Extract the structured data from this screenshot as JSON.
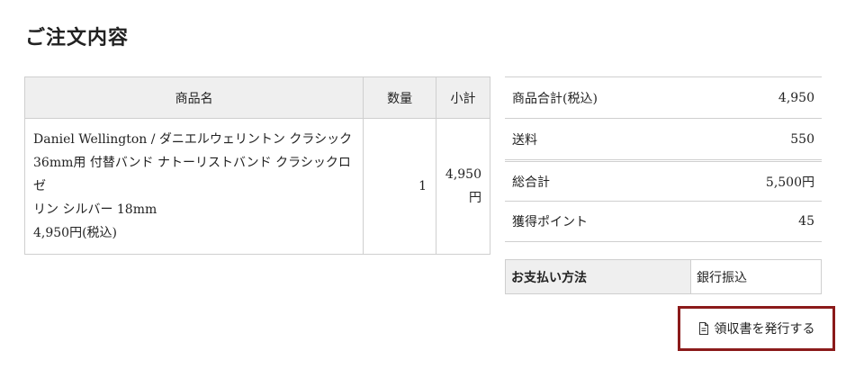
{
  "page": {
    "title": "ご注文内容"
  },
  "items_table": {
    "headers": {
      "name": "商品名",
      "quantity": "数量",
      "subtotal": "小計"
    },
    "rows": [
      {
        "name_lines": [
          "Daniel Wellington / ダニエルウェリントン クラシック",
          "36mm用 付替バンド ナトーリストバンド クラシックロゼ",
          "リン シルバー 18mm",
          "4,950円(税込)"
        ],
        "quantity": "1",
        "subtotal_amount": "4,950",
        "subtotal_unit": "円"
      }
    ]
  },
  "summary": {
    "rows": [
      {
        "label": "商品合計(税込)",
        "value": "4,950"
      },
      {
        "label": "送料",
        "value": "550"
      },
      {
        "label": "総合計",
        "value": "5,500円"
      },
      {
        "label": "獲得ポイント",
        "value": "45"
      }
    ]
  },
  "payment": {
    "label": "お支払い方法",
    "value": "銀行振込"
  },
  "receipt_button": {
    "label": "領収書を発行する",
    "icon": "document-icon"
  },
  "colors": {
    "accent": "#8b1a1a",
    "header_bg": "#efefef",
    "border": "#cfcfcf"
  }
}
